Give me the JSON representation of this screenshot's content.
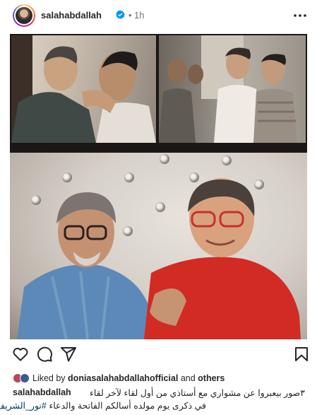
{
  "header": {
    "username": "salahabdallah",
    "separator": "•",
    "time": "1h"
  },
  "post": {
    "actions": [
      "heart-icon",
      "comment-icon",
      "share-icon",
      "bookmark-icon"
    ]
  },
  "likes": {
    "prefix": "Liked by",
    "user": "doniasalahabdallahofficial",
    "middle": "and",
    "others": "others"
  },
  "caption": {
    "username": "salahabdallah",
    "line1": "٣صور بيعبروا عن مشواري مع أستاذي من أول لقاء لآخر لقاء",
    "line2_text": "في ذكرى يوم مولده أسالكم الفاتحة والدعاء",
    "hashtag": "#نور_الشريف"
  },
  "colors": {
    "text": "#262626",
    "muted": "#737373",
    "verified": "#0095f6",
    "hashtag": "#00376b"
  }
}
